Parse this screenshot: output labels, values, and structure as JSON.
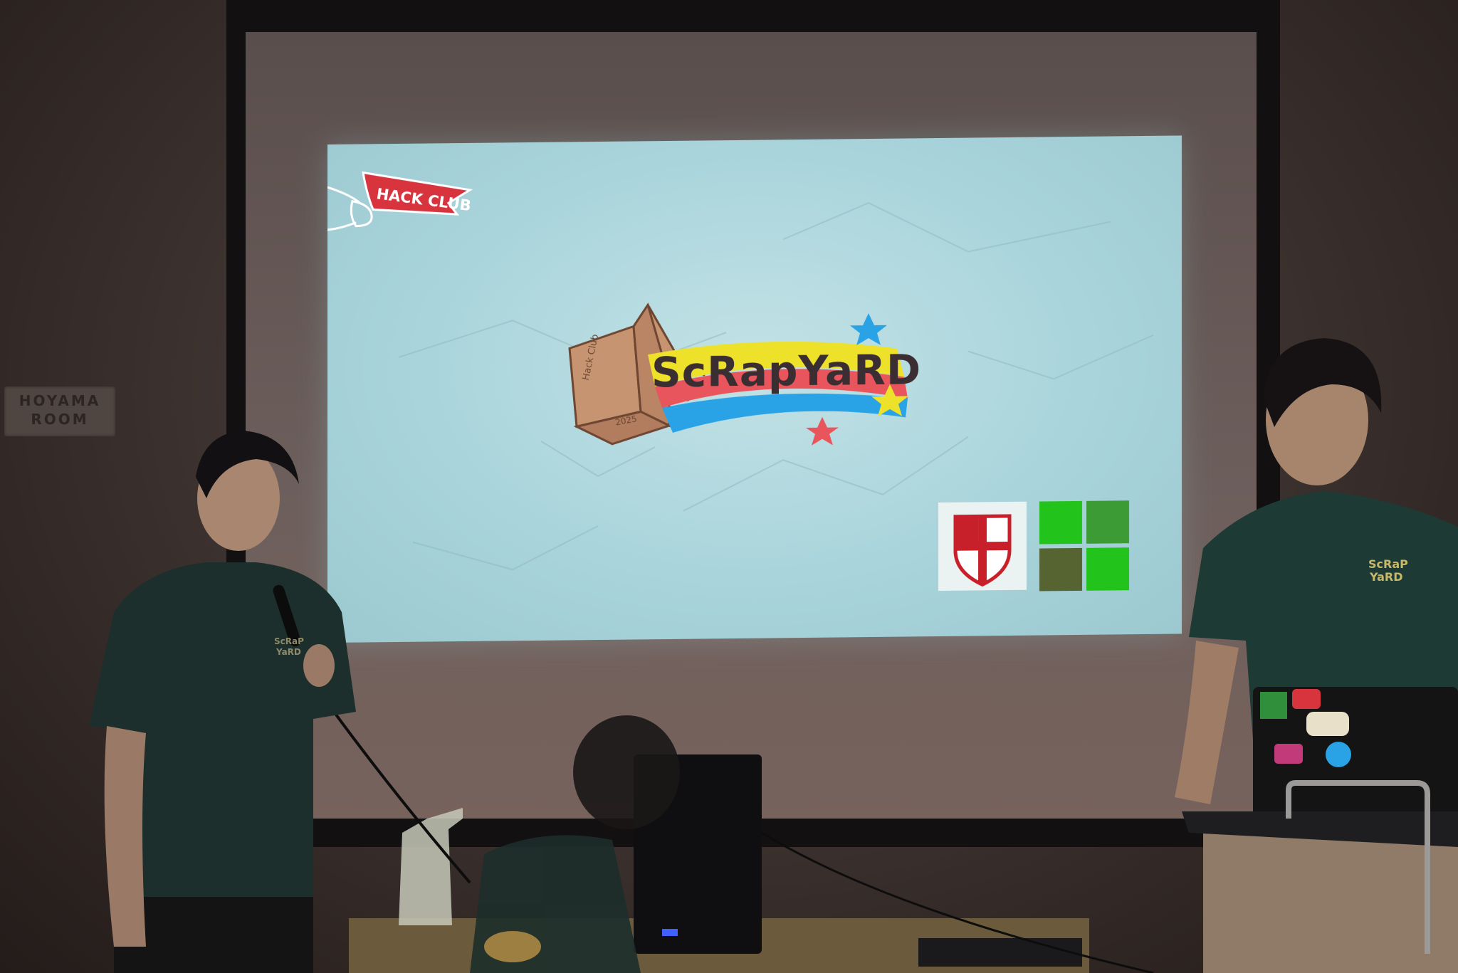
{
  "scene": {
    "room_sign": [
      "HOYAMA",
      "ROOM"
    ]
  },
  "slide": {
    "pennant_text": "HACK CLUB",
    "logo_text": "ScRapYaRD",
    "box_label": "Hack Club",
    "box_year": "2025"
  },
  "shirt_print": {
    "line1": "ScRaP",
    "line2": "YaRD"
  },
  "colors": {
    "slide_bg": "#b6dde2",
    "logo_yellow": "#ede12a",
    "logo_red": "#e8555c",
    "logo_blue": "#2aa3e6",
    "pennant_red": "#d8343e",
    "square_green": "#22c31a",
    "square_olive": "#566431",
    "shirt_green": "#1f3b37"
  }
}
